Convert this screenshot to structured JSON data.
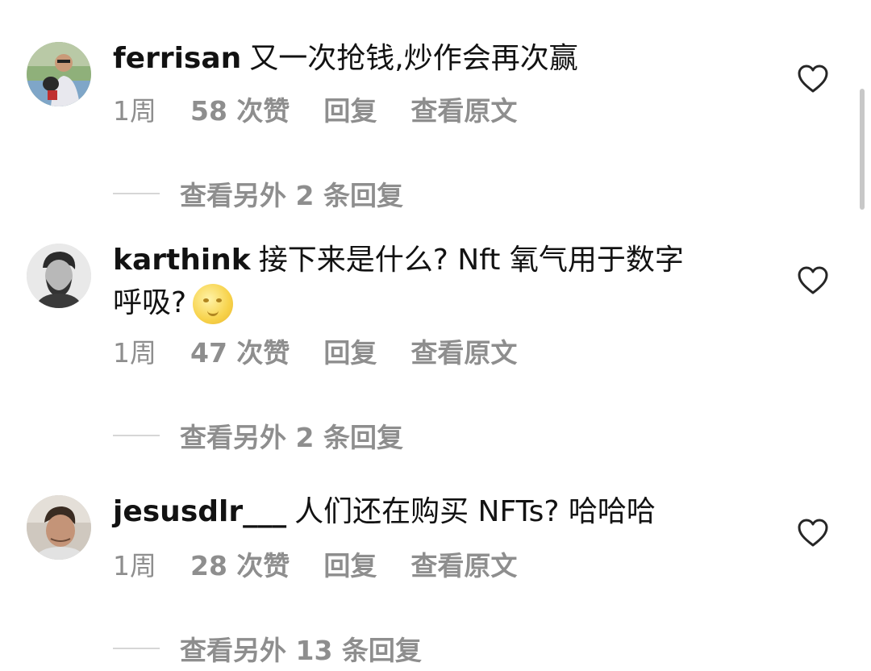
{
  "comments": [
    {
      "username": "ferrisan",
      "text": "又一次抢钱,炒作会再次赢",
      "text2": "",
      "time": "1周",
      "likes": "58 次赞",
      "reply": "回复",
      "translate": "查看原文",
      "view_replies": "查看另外 2 条回复",
      "avatar": "person-with-dog-avatar"
    },
    {
      "username": "karthink",
      "text": "接下来是什么? Nft 氧气用于数字",
      "text2": "呼吸?",
      "emoji": "full-moon-face-emoji",
      "time": "1周",
      "likes": "47 次赞",
      "reply": "回复",
      "translate": "查看原文",
      "view_replies": "查看另外 2 条回复",
      "avatar": "bearded-man-bw-avatar"
    },
    {
      "username": "jesusdlr___",
      "text": "人们还在购买 NFTs? 哈哈哈",
      "text2": "",
      "time": "1周",
      "likes": "28 次赞",
      "reply": "回复",
      "translate": "查看原文",
      "view_replies": "查看另外 13 条回复",
      "avatar": "young-man-avatar"
    }
  ],
  "icons": {
    "like": "heart-outline-icon"
  },
  "colors": {
    "text": "#121212",
    "muted": "#8e8e8e",
    "divider": "#d6d6d6"
  }
}
